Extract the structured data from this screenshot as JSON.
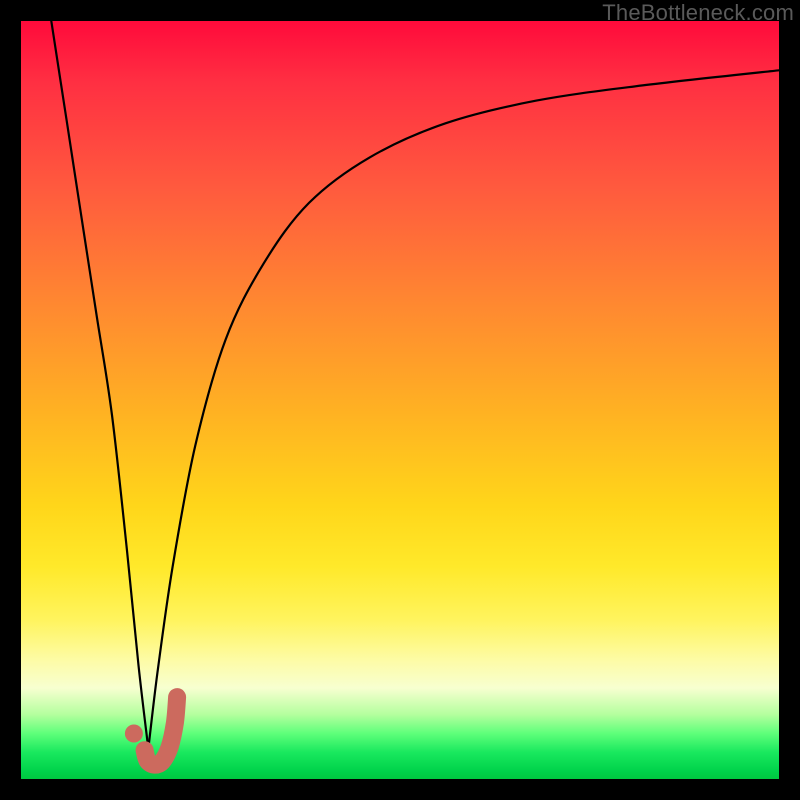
{
  "watermark": "TheBottleneck.com",
  "colors": {
    "frame": "#000000",
    "curve": "#000000",
    "accent": "#cc6a5e",
    "gradient_top": "#ff0a3b",
    "gradient_bottom": "#00c840"
  },
  "chart_data": {
    "type": "line",
    "title": "",
    "xlabel": "",
    "ylabel": "",
    "xlim": [
      0,
      100
    ],
    "ylim": [
      0,
      100
    ],
    "note": "Axes unlabeled; values are relative 0–100 estimated from pixels. y=0 is bottom (green), y=100 is top (red).",
    "series": [
      {
        "name": "left-branch",
        "x": [
          4,
          6,
          8,
          10,
          12,
          14,
          15.5,
          16.8
        ],
        "y": [
          100,
          87,
          74,
          61,
          48,
          30,
          15,
          4
        ]
      },
      {
        "name": "right-branch",
        "x": [
          16.8,
          18,
          20,
          23,
          27,
          32,
          38,
          46,
          56,
          68,
          82,
          100
        ],
        "y": [
          4,
          14,
          28,
          44,
          58,
          68,
          76,
          82,
          86.5,
          89.5,
          91.5,
          93.5
        ]
      }
    ],
    "accent_curve": {
      "name": "J-accent",
      "x": [
        16.3,
        16.7,
        17.6,
        18.6,
        19.6,
        20.3,
        20.6
      ],
      "y": [
        3.8,
        2.4,
        1.9,
        2.3,
        4.2,
        7.4,
        10.8
      ]
    },
    "accent_dot": {
      "x": 14.9,
      "y": 6.0
    },
    "grid": false,
    "legend": false
  }
}
